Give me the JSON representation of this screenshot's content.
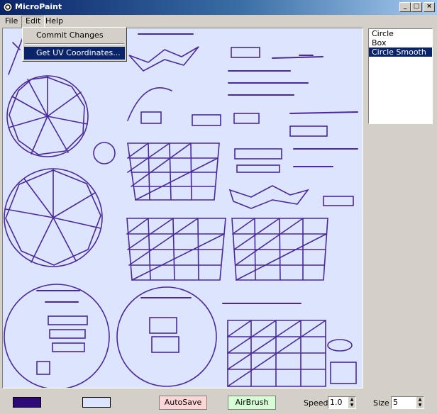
{
  "window": {
    "title": "MicroPaint"
  },
  "menubar": {
    "items": [
      "File",
      "Edit",
      "Help"
    ]
  },
  "edit_menu": {
    "items": [
      "Commit Changes",
      "Get UV Coordinates..."
    ]
  },
  "objects_list": {
    "items": [
      "Circle",
      "Box",
      "Circle Smooth"
    ],
    "selected": "Circle Smooth"
  },
  "bottombar": {
    "primary_color": "#2e0a78",
    "secondary_color": "#dde4fd",
    "autosave_label": "AutoSave",
    "airbrush_label": "AirBrush",
    "speed_label": "Speed",
    "speed_value": "1.0",
    "size_label": "Size",
    "size_value": "5"
  },
  "colors": {
    "canvas_bg": "#dde4fd",
    "stroke": "#4a2a9a",
    "title_start": "#0a246a",
    "title_end": "#a6caf0"
  }
}
